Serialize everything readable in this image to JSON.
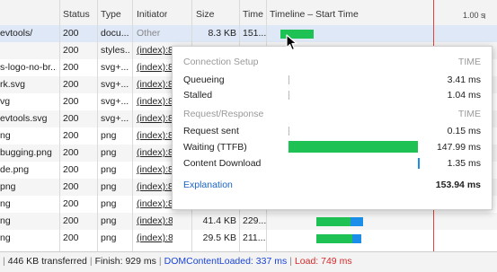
{
  "columns": {
    "status": "Status",
    "type": "Type",
    "initiator": "Initiator",
    "size": "Size",
    "time": "Time",
    "timeline": "Timeline – Start Time",
    "scale_label": "1.00 s"
  },
  "rows": [
    {
      "name": "evtools/",
      "status": "200",
      "type": "docu...",
      "initiator": "Other",
      "size": "8.3 KB",
      "time": "151..."
    },
    {
      "name": "",
      "status": "200",
      "type": "styles...",
      "initiator": "(index):8",
      "size": "",
      "time": ""
    },
    {
      "name": "s-logo-no-br...",
      "status": "200",
      "type": "svg+...",
      "initiator": "(index):8",
      "size": "",
      "time": ""
    },
    {
      "name": "rk.svg",
      "status": "200",
      "type": "svg+...",
      "initiator": "(index):8",
      "size": "",
      "time": ""
    },
    {
      "name": "vg",
      "status": "200",
      "type": "svg+...",
      "initiator": "(index):8",
      "size": "",
      "time": ""
    },
    {
      "name": "evtools.svg",
      "status": "200",
      "type": "svg+...",
      "initiator": "(index):8",
      "size": "",
      "time": ""
    },
    {
      "name": "ng",
      "status": "200",
      "type": "png",
      "initiator": "(index):8",
      "size": "",
      "time": ""
    },
    {
      "name": "bugging.png",
      "status": "200",
      "type": "png",
      "initiator": "(index):8",
      "size": "",
      "time": ""
    },
    {
      "name": "de.png",
      "status": "200",
      "type": "png",
      "initiator": "(index):8",
      "size": "",
      "time": ""
    },
    {
      "name": "png",
      "status": "200",
      "type": "png",
      "initiator": "(index):8",
      "size": "",
      "time": ""
    },
    {
      "name": "ng",
      "status": "200",
      "type": "png",
      "initiator": "(index):8",
      "size": "11.4 KB",
      "time": "358..."
    },
    {
      "name": "ng",
      "status": "200",
      "type": "png",
      "initiator": "(index):8",
      "size": "41.4 KB",
      "time": "229..."
    },
    {
      "name": "ng",
      "status": "200",
      "type": "png",
      "initiator": "(index):8",
      "size": "29.5 KB",
      "time": "211..."
    }
  ],
  "tooltip": {
    "connection_setup": "Connection Setup",
    "time_header": "TIME",
    "queueing": {
      "label": "Queueing",
      "value": "3.41 ms"
    },
    "stalled": {
      "label": "Stalled",
      "value": "1.04 ms"
    },
    "request_response": "Request/Response",
    "time_header2": "TIME",
    "request_sent": {
      "label": "Request sent",
      "value": "0.15 ms"
    },
    "waiting": {
      "label": "Waiting (TTFB)",
      "value": "147.99 ms"
    },
    "content_download": {
      "label": "Content Download",
      "value": "1.35 ms"
    },
    "explanation": "Explanation",
    "total": "153.94 ms"
  },
  "status_bar": {
    "transferred": "446 KB transferred",
    "finish": "Finish: 929 ms",
    "dom_content_loaded": "DOMContentLoaded: 337 ms",
    "load": "Load: 749 ms"
  },
  "colors": {
    "waiting": "#1ec254",
    "download": "#1a8ee8",
    "load_line": "#e0443a",
    "dcl": "#1a44d8",
    "load": "#d52a2a",
    "link": "#1a63c8"
  }
}
